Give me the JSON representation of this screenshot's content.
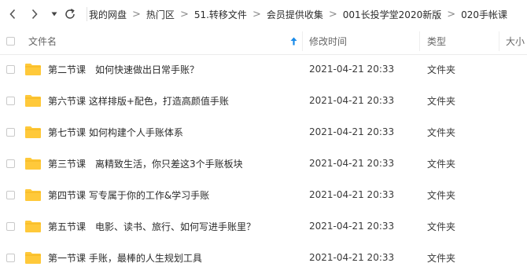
{
  "toolbar": {
    "back_icon": "chevron-left-icon",
    "forward_icon": "chevron-right-icon",
    "history_icon": "caret-down-icon",
    "refresh_icon": "refresh-icon"
  },
  "breadcrumb": [
    "我的网盘",
    "热门区",
    "51.转移文件",
    "会员提供收集",
    "001长投学堂2020新版",
    "020手帐课"
  ],
  "columns": {
    "name": "文件名",
    "modified": "修改时间",
    "type": "类型",
    "size": "大小"
  },
  "sort_icon": "sort-ascending-arrow-icon",
  "accent_color": "#1a8be8",
  "folder_color": "#ffc93a",
  "files": [
    {
      "name": "第二节课　如何快速做出日常手账？",
      "modified": "2021-04-21 20:33",
      "type": "文件夹"
    },
    {
      "name": "第六节课  这样排版+配色，打造高颜值手账",
      "modified": "2021-04-21 20:33",
      "type": "文件夹"
    },
    {
      "name": "第七节课 如何构建个人手账体系",
      "modified": "2021-04-21 20:33",
      "type": "文件夹"
    },
    {
      "name": "第三节课　离精致生活，你只差这3个手账板块",
      "modified": "2021-04-21 20:33",
      "type": "文件夹"
    },
    {
      "name": "第四节课  写专属于你的工作&学习手账",
      "modified": "2021-04-21 20:33",
      "type": "文件夹"
    },
    {
      "name": "第五节课　电影、读书、旅行、如何写进手账里？",
      "modified": "2021-04-21 20:33",
      "type": "文件夹"
    },
    {
      "name": "第一节课  手账，最棒的人生规划工具",
      "modified": "2021-04-21 20:33",
      "type": "文件夹"
    }
  ]
}
